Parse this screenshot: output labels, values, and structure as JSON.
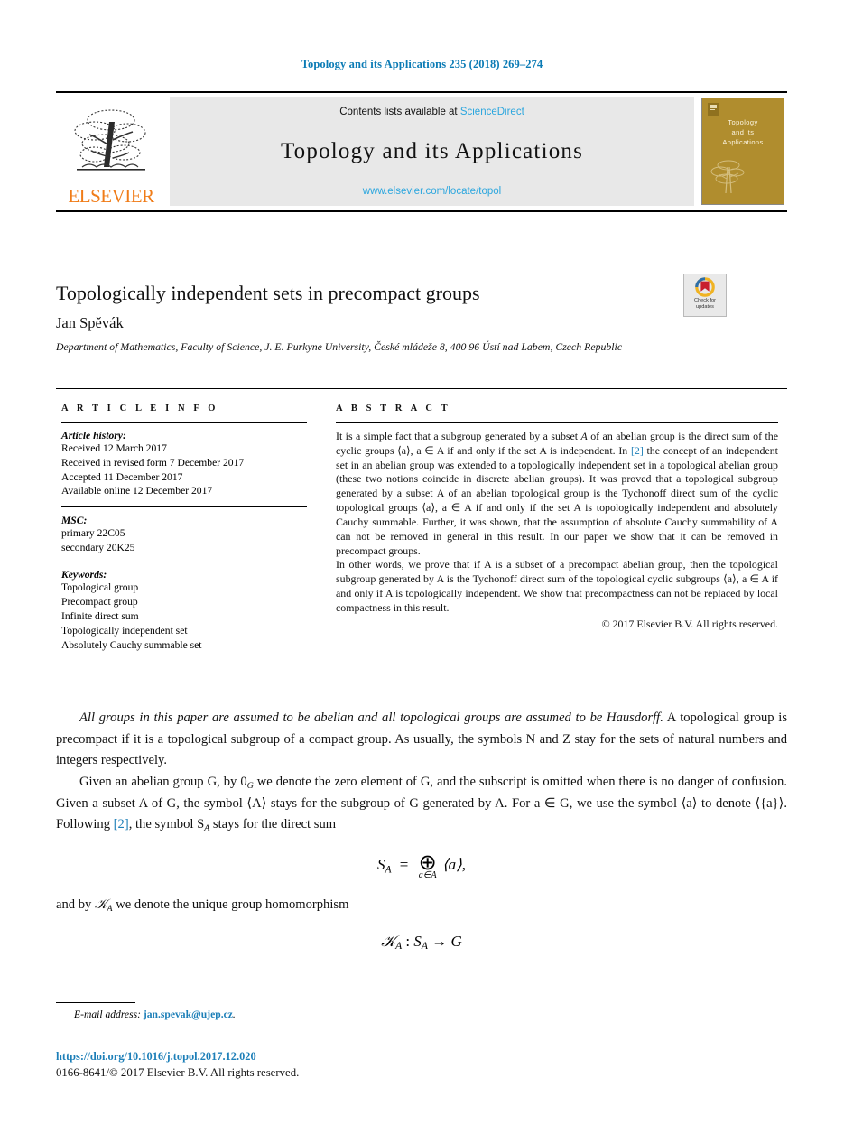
{
  "running_head": "Topology and its Applications 235 (2018) 269–274",
  "masthead": {
    "publisher_name": "ELSEVIER",
    "contents_prefix": "Contents lists available at",
    "contents_link": "ScienceDirect",
    "journal_title": "Topology and its Applications",
    "journal_url": "www.elsevier.com/locate/topol",
    "cover_title": "Topology\nand its\nApplications"
  },
  "article": {
    "title": "Topologically independent sets in precompact groups",
    "author": "Jan Spěvák",
    "affiliation": "Department of Mathematics, Faculty of Science, J. E. Purkyne University, České mládeže 8, 400 96 Ústí nad Labem, Czech Republic",
    "crossmark_label": "Check for\nupdates"
  },
  "info": {
    "heading": "A R T I C L E   I N F O",
    "history_label": "Article history:",
    "history": [
      "Received 12 March 2017",
      "Received in revised form 7 December 2017",
      "Accepted 11 December 2017",
      "Available online 12 December 2017"
    ],
    "msc_label": "MSC:",
    "msc": [
      "primary 22C05",
      "secondary 20K25"
    ],
    "keywords_label": "Keywords:",
    "keywords": [
      "Topological group",
      "Precompact group",
      "Infinite direct sum",
      "Topologically independent set",
      "Absolutely Cauchy summable set"
    ]
  },
  "abstract": {
    "heading": "A B S T R A C T",
    "paragraph_1_a": "It is a simple fact that a subgroup generated by a subset ",
    "paragraph_1_b": " of an abelian group is the direct sum of the cyclic groups ⟨a⟩, a ∈ A if and only if the set A is independent. In ",
    "ref_2": "[2]",
    "paragraph_1_c": " the concept of an independent set in an abelian group was extended to a topologically independent set in a topological abelian group (these two notions coincide in discrete abelian groups). It was proved that a topological subgroup generated by a subset A of an abelian topological group is the Tychonoff direct sum of the cyclic topological groups ⟨a⟩, a ∈ A if and only if the set A is topologically independent and absolutely Cauchy summable. Further, it was shown, that the assumption of absolute Cauchy summability of A can not be removed in general in this result. In our paper we show that it can be removed in precompact groups.",
    "paragraph_2": "In other words, we prove that if A is a subset of a precompact abelian group, then the topological subgroup generated by A is the Tychonoff direct sum of the topological cyclic subgroups ⟨a⟩, a ∈ A if and only if A is topologically independent. We show that precompactness can not be replaced by local compactness in this result.",
    "copyright": "© 2017 Elsevier B.V. All rights reserved."
  },
  "body": {
    "p1_italic": "All groups in this paper are assumed to be abelian and all topological groups are assumed to be Hausdorff.",
    "p1_rest": " A topological group is precompact if it is a topological subgroup of a compact group. As usually, the symbols N and Z stay for the sets of natural numbers and integers respectively.",
    "p2_a": "Given an abelian group G, by 0",
    "p2_sub": "G",
    "p2_b": " we denote the zero element of G, and the subscript is omitted when there is no danger of confusion. Given a subset A of G, the symbol ⟨A⟩ stays for the subgroup of G generated by A. For a ∈ G, we use the symbol ⟨a⟩ to denote ⟨{a}⟩. Following ",
    "p2_ref": "[2]",
    "p2_c": ", the symbol S",
    "p2_sub2": "A",
    "p2_d": " stays for the direct sum",
    "eq1_lhs": "S",
    "eq1_lhs_sub": "A",
    "eq1_eq": "=",
    "eq1_op": "⊕",
    "eq1_op_sub": "a∈A",
    "eq1_rhs": "⟨a⟩,",
    "p3_a": "and by ",
    "p3_k": "𝒦",
    "p3_k_sub": "A",
    "p3_b": " we denote the unique group homomorphism",
    "eq2_k": "𝒦",
    "eq2_k_sub": "A",
    "eq2_colon": " : ",
    "eq2_s": "S",
    "eq2_s_sub": "A",
    "eq2_arrow": " → ",
    "eq2_g": "G"
  },
  "footer": {
    "email_label": "E-mail address:",
    "email": "jan.spevak@ujep.cz",
    "email_period": ".",
    "doi": "https://doi.org/10.1016/j.topol.2017.12.020",
    "issn_line": "0166-8641/© 2017 Elsevier B.V. All rights reserved."
  },
  "colors": {
    "link": "#1d7fb8",
    "header_blue": "#0b7bb5",
    "sciencedirect": "#2ba6de",
    "elsevier_orange": "#f07c18",
    "cover_gold": "#b08d2e"
  }
}
